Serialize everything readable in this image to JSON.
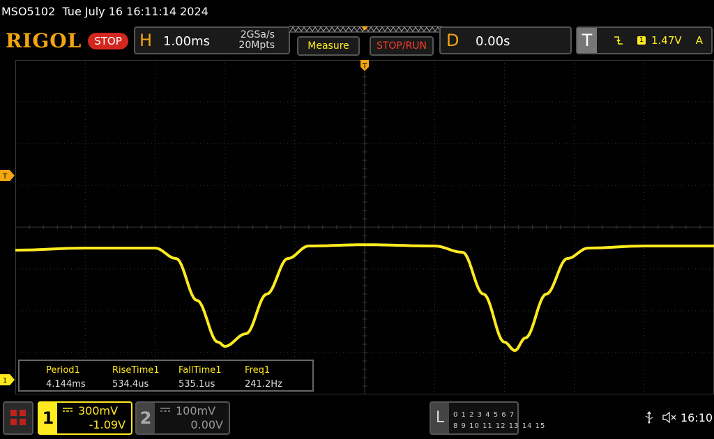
{
  "title": {
    "model": "MSO5102",
    "datetime": "Tue July 16 16:11:14 2024"
  },
  "toolbar": {
    "logo": "RIGOL",
    "run_state": "STOP",
    "horizontal": {
      "letter": "H",
      "timebase": "1.00ms",
      "sample_rate": "2GSa/s",
      "memory_depth": "20Mpts"
    },
    "measure_label": "Measure",
    "stoprun_label": "STOP/RUN",
    "delay": {
      "letter": "D",
      "value": "0.00s"
    },
    "trigger": {
      "letter": "T",
      "channel": "1",
      "level": "1.47V",
      "mode": "A"
    }
  },
  "markers": {
    "trigger_top": "T",
    "trigger_level": "T",
    "channel1": "1"
  },
  "measurements": [
    {
      "label": "Period1",
      "value": "4.144ms"
    },
    {
      "label": "RiseTime1",
      "value": "534.4us"
    },
    {
      "label": "FallTime1",
      "value": "535.1us"
    },
    {
      "label": "Freq1",
      "value": "241.2Hz"
    }
  ],
  "channels": [
    {
      "number": "1",
      "scale": "300mV",
      "offset": "-1.09V",
      "active": true
    },
    {
      "number": "2",
      "scale": "100mV",
      "offset": "0.00V",
      "active": false
    }
  ],
  "logic": {
    "letter": "L",
    "row1": "0 1 2 3  4 5 6 7",
    "row2": "8 9 10 11 12 13 14 15"
  },
  "status": {
    "clock": "16:10"
  },
  "colors": {
    "trace": "#ffea1f",
    "logo": "#f2a510",
    "stop": "#d2271f",
    "grid": "#3a3a3a"
  },
  "chart_data": {
    "type": "line",
    "timebase_per_div": "1.00ms",
    "volts_per_div": "300mV",
    "divisions_x": 10,
    "divisions_y": 8,
    "series": [
      {
        "x_div": [
          0,
          1.0,
          2.0,
          2.3,
          2.6,
          2.9,
          3.0,
          3.3,
          3.6,
          3.9,
          4.2,
          5.0,
          6.0,
          6.4,
          6.7,
          7.0,
          7.15,
          7.3,
          7.6,
          7.9,
          8.2,
          9.0,
          10.0
        ],
        "y_div": [
          -0.55,
          -0.5,
          -0.5,
          -0.75,
          -1.75,
          -2.75,
          -2.85,
          -2.55,
          -1.6,
          -0.75,
          -0.45,
          -0.42,
          -0.45,
          -0.6,
          -1.6,
          -2.75,
          -2.95,
          -2.65,
          -1.6,
          -0.75,
          -0.5,
          -0.45,
          -0.45
        ]
      }
    ],
    "grid": true
  }
}
